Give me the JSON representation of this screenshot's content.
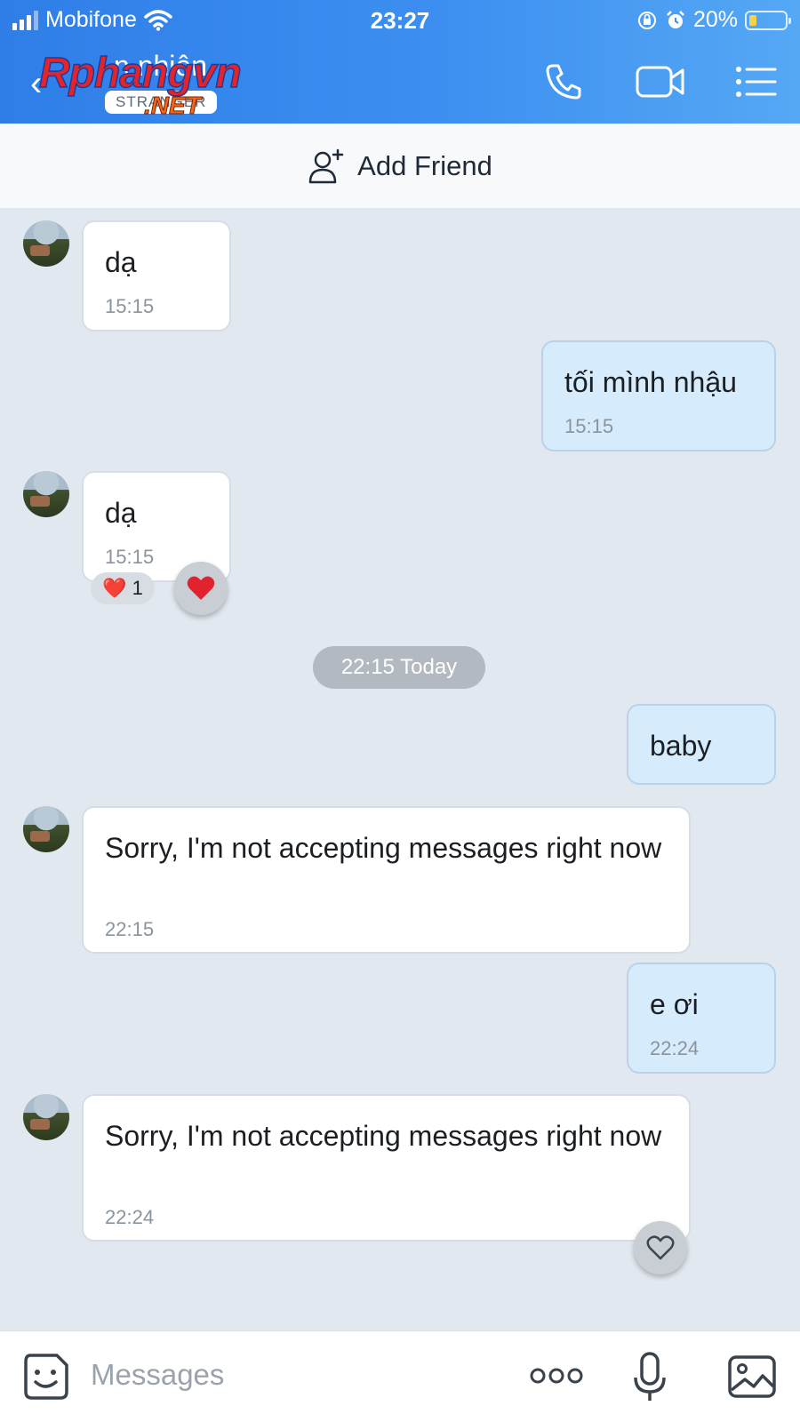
{
  "status_bar": {
    "carrier": "Mobifone",
    "time": "23:27",
    "battery": "20%",
    "battery_level": 0.2
  },
  "header": {
    "contact_name": "n nhiên",
    "stranger_label": "STRANGER",
    "watermark_main": "Rphangvn",
    "watermark_sub": ".NET",
    "icons": [
      "back-icon",
      "phone-icon",
      "video-call-icon",
      "menu-list-icon"
    ]
  },
  "add_friend": {
    "label": "Add Friend"
  },
  "messages": [
    {
      "side": "in",
      "text": "dạ",
      "time": "15:15"
    },
    {
      "side": "out",
      "text": "tối mình nhậu",
      "time": "15:15"
    },
    {
      "side": "in",
      "text": "dạ",
      "time": "15:15",
      "reaction_count": "1",
      "reaction_emoji": "❤️"
    },
    {
      "side": "out",
      "text": "baby"
    },
    {
      "side": "in",
      "text": "Sorry, I'm not accepting messages right now",
      "time": "22:15"
    },
    {
      "side": "out",
      "text": "e ơi",
      "time": "22:24"
    },
    {
      "side": "in",
      "text": "Sorry, I'm not accepting messages right now",
      "time": "22:24"
    }
  ],
  "date_separator": "22:15 Today",
  "input": {
    "placeholder": "Messages"
  },
  "colors": {
    "header_start": "#2f7ee8",
    "header_end": "#55a8f4",
    "chat_bg": "#e2e8f0",
    "out_bubble": "#d6ebfb",
    "in_bubble": "#ffffff"
  }
}
